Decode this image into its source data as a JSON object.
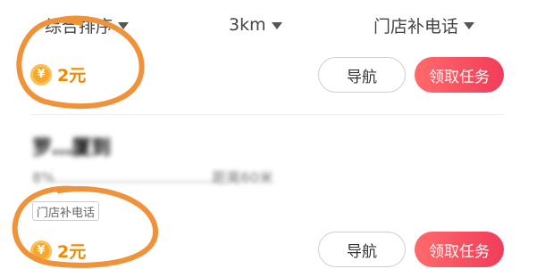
{
  "filters": {
    "sort_label": "综合排序",
    "distance_label": "3km",
    "type_label": "门店补电话"
  },
  "listings": [
    {
      "reward": "2元",
      "nav_label": "导航",
      "task_label": "领取任务"
    },
    {
      "store_name": "罗…厦到",
      "info": "8%……………………………距离60米",
      "tag": "门店补电话",
      "reward": "2元",
      "nav_label": "导航",
      "task_label": "领取任务"
    }
  ],
  "coin_symbol": "¥",
  "colors": {
    "reward": "#f08a00",
    "task_button": "#f23c5a",
    "annotation": "#f0923a"
  },
  "icons": [
    "dropdown-triangle-icon",
    "coin-icon"
  ]
}
